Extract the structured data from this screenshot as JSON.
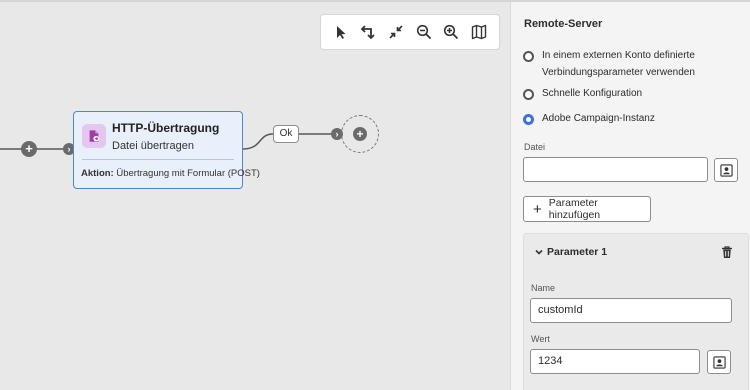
{
  "toolbar": {
    "tools": [
      {
        "name": "select-tool",
        "icon": "pointer-icon"
      },
      {
        "name": "reorganize-tool",
        "icon": "swap-arrows-icon"
      },
      {
        "name": "collapse-tool",
        "icon": "collapse-arrows-icon"
      },
      {
        "name": "zoom-out-tool",
        "icon": "zoom-out-icon"
      },
      {
        "name": "zoom-in-tool",
        "icon": "zoom-in-icon"
      },
      {
        "name": "map-tool",
        "icon": "map-icon"
      }
    ]
  },
  "canvas": {
    "activity": {
      "title": "HTTP-Übertragung",
      "subtitle": "Datei übertragen",
      "action_label": "Aktion:",
      "action_value": " Übertragung mit Formular (POST)",
      "icon": "http-transfer-icon"
    },
    "transition_label": "Ok"
  },
  "panel": {
    "title": "Remote-Server",
    "options": [
      {
        "label": "In einem externen Konto definierte Verbindungsparameter verwenden",
        "checked": false
      },
      {
        "label": "Schnelle Konfiguration",
        "checked": false
      },
      {
        "label": "Adobe Campaign-Instanz",
        "checked": true
      }
    ],
    "file_label": "Datei",
    "file_value": "",
    "add_parameter_label": "Parameter hinzufügen",
    "parameter": {
      "title": "Parameter 1",
      "name_label": "Name",
      "name_value": "customId",
      "value_label": "Wert",
      "value_value": "1234"
    }
  },
  "colors": {
    "accent": "#3b70e0",
    "activity_bg": "#e9f0fb",
    "activity_border": "#4d86e0",
    "activity_icon_bg": "#e3c7ef"
  }
}
